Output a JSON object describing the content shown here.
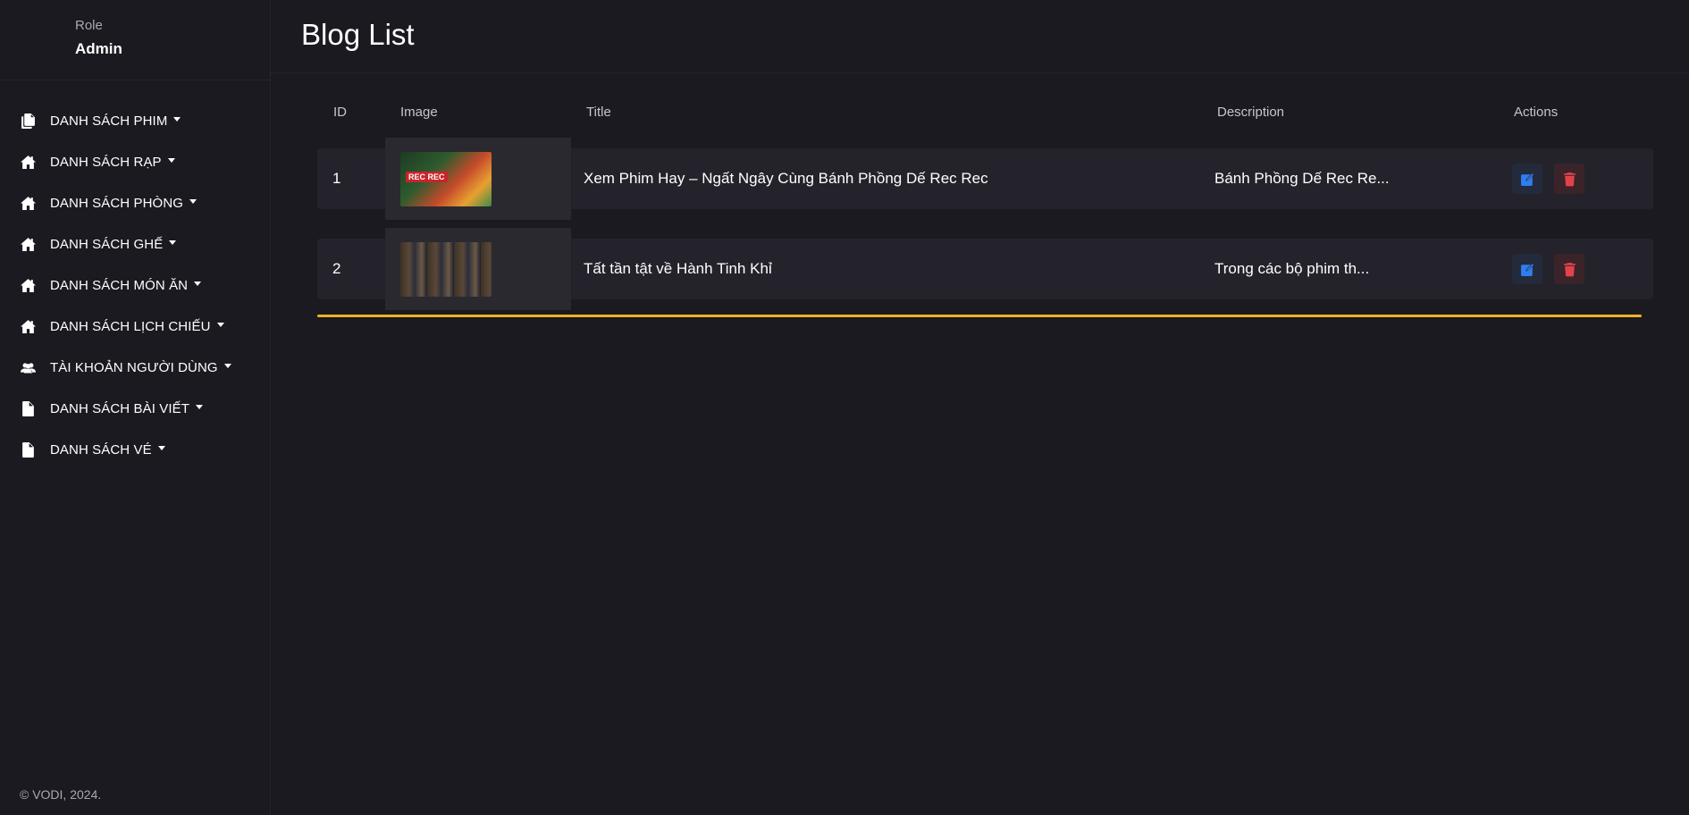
{
  "sidebar": {
    "role_label": "Role",
    "role_value": "Admin",
    "items": [
      {
        "label": "DANH SÁCH PHIM",
        "icon": "copy-icon"
      },
      {
        "label": "DANH SÁCH RẠP",
        "icon": "home-icon"
      },
      {
        "label": "DANH SÁCH PHÒNG",
        "icon": "home-icon"
      },
      {
        "label": "DANH SÁCH GHẾ",
        "icon": "home-icon"
      },
      {
        "label": "DANH SÁCH MÓN ĂN",
        "icon": "home-icon"
      },
      {
        "label": "DANH SÁCH LỊCH CHIẾU",
        "icon": "home-icon"
      },
      {
        "label": "TÀI KHOẢN NGƯỜI DÙNG",
        "icon": "users-icon"
      },
      {
        "label": "DANH SÁCH BÀI VIẾT",
        "icon": "file-icon"
      },
      {
        "label": "DANH SÁCH VÉ",
        "icon": "file-icon"
      }
    ],
    "footer": "© VODI, 2024."
  },
  "page": {
    "title": "Blog List"
  },
  "table": {
    "headers": {
      "id": "ID",
      "image": "Image",
      "title": "Title",
      "description": "Description",
      "actions": "Actions"
    },
    "rows": [
      {
        "id": "1",
        "title": "Xem Phim Hay – Ngất Ngây Cùng Bánh Phồng Dế Rec Rec",
        "description": "Bánh Phồng Dế Rec Re...",
        "thumbnail_text": "REC REC"
      },
      {
        "id": "2",
        "title": "Tất tần tật về Hành Tinh Khỉ",
        "description": "Trong các bộ phim th..."
      }
    ]
  },
  "colors": {
    "background": "#1b1a21",
    "row": "#24232b",
    "edit_icon": "#2f7ef0",
    "delete_icon": "#e0434a",
    "loader": "#f0b323"
  }
}
